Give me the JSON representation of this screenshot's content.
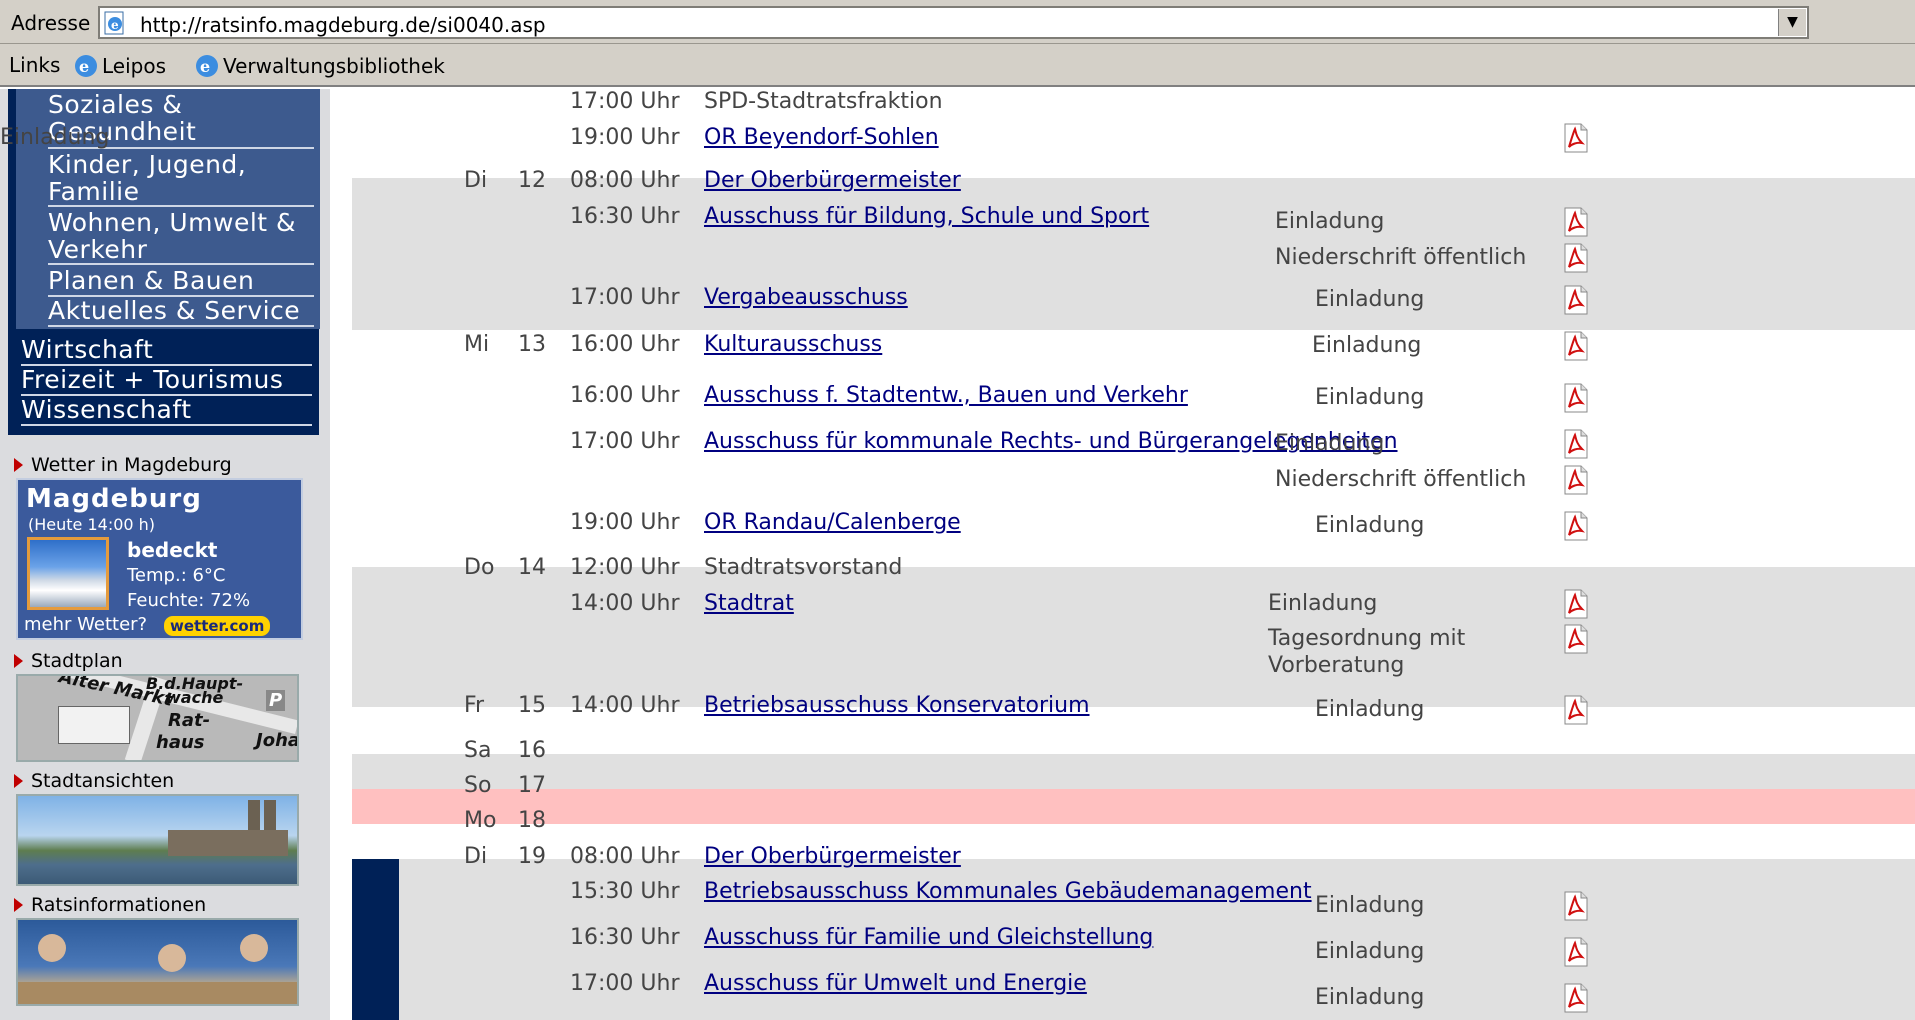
{
  "browser": {
    "address_label": "Adresse",
    "url": "http://ratsinfo.magdeburg.de/si0040.asp",
    "links_label": "Links",
    "links": [
      "Leipos",
      "Verwaltungsbibliothek"
    ]
  },
  "sidebar": {
    "subnav": [
      {
        "line1": "Soziales &",
        "line2": "Gesundheit"
      },
      {
        "line1": "Kinder, Jugend,",
        "line2": "Familie"
      },
      {
        "line1": "Wohnen, Umwelt &",
        "line2": "Verkehr"
      },
      {
        "line1": "Planen & Bauen",
        "line2": ""
      },
      {
        "line1": "Aktuelles & Service",
        "line2": ""
      }
    ],
    "mainnav": [
      "Wirtschaft",
      "Freizeit + Tourismus",
      "Wissenschaft"
    ],
    "weather": {
      "heading": "Wetter in Magdeburg",
      "city": "Magdeburg",
      "time": "(Heute 14:00 h)",
      "condition": "bedeckt",
      "temp": "Temp.:  6°C",
      "humidity": "Feuchte: 72%",
      "more": "mehr Wetter?",
      "badge": "wetter.com"
    },
    "stadtplan": {
      "heading": "Stadtplan",
      "labels": [
        "Alter Markt",
        "B.d.Haupt-",
        "wache",
        "Rat-",
        "haus",
        "Johan",
        "P"
      ]
    },
    "stadtansichten": {
      "heading": "Stadtansichten"
    },
    "ratsinfo": {
      "heading": "Ratsinformationen"
    }
  },
  "calendar": {
    "entries": [
      {
        "day": "",
        "date": "",
        "time": "17:00 Uhr",
        "title": "SPD-Stadtratsfraktion",
        "link": false,
        "docs": []
      },
      {
        "day": "",
        "date": "",
        "time": "19:00 Uhr",
        "title": "OR Beyendorf-Sohlen",
        "link": true,
        "docs": [
          "Einladung"
        ]
      },
      {
        "day": "Di",
        "date": "12",
        "time": "08:00 Uhr",
        "title": "Der Oberbürgermeister",
        "link": true,
        "docs": []
      },
      {
        "day": "",
        "date": "",
        "time": "16:30 Uhr",
        "title": "Ausschuss für Bildung, Schule und Sport",
        "link": true,
        "docs": [
          "Einladung",
          "Niederschrift öffentlich"
        ]
      },
      {
        "day": "",
        "date": "",
        "time": "17:00 Uhr",
        "title": "Vergabeausschuss",
        "link": true,
        "docs": [
          "Einladung"
        ]
      },
      {
        "day": "Mi",
        "date": "13",
        "time": "16:00 Uhr",
        "title": "Kulturausschuss",
        "link": true,
        "docs": [
          "Einladung"
        ]
      },
      {
        "day": "",
        "date": "",
        "time": "16:00 Uhr",
        "title": "Ausschuss f. Stadtentw., Bauen und Verkehr",
        "link": true,
        "docs": [
          "Einladung"
        ]
      },
      {
        "day": "",
        "date": "",
        "time": "17:00 Uhr",
        "title": "Ausschuss für kommunale Rechts- und Bürgerangelegenheiten",
        "link": true,
        "docs": [
          "Einladung",
          "Niederschrift öffentlich"
        ]
      },
      {
        "day": "",
        "date": "",
        "time": "19:00 Uhr",
        "title": "OR Randau/Calenberge",
        "link": true,
        "docs": [
          "Einladung"
        ]
      },
      {
        "day": "Do",
        "date": "14",
        "time": "12:00 Uhr",
        "title": "Stadtratsvorstand",
        "link": false,
        "docs": []
      },
      {
        "day": "",
        "date": "",
        "time": "14:00 Uhr",
        "title": "Stadtrat",
        "link": true,
        "docs": [
          "Einladung",
          "Tagesordnung mit",
          "Vorberatung"
        ]
      },
      {
        "day": "Fr",
        "date": "15",
        "time": "14:00 Uhr",
        "title": "Betriebsausschuss Konservatorium",
        "link": true,
        "docs": [
          "Einladung"
        ]
      },
      {
        "day": "Sa",
        "date": "16",
        "time": "",
        "title": "",
        "link": false,
        "docs": []
      },
      {
        "day": "So",
        "date": "17",
        "time": "",
        "title": "",
        "link": false,
        "docs": []
      },
      {
        "day": "Mo",
        "date": "18",
        "time": "",
        "title": "",
        "link": false,
        "docs": []
      },
      {
        "day": "Di",
        "date": "19",
        "time": "08:00 Uhr",
        "title": "Der Oberbürgermeister",
        "link": true,
        "docs": []
      },
      {
        "day": "",
        "date": "",
        "time": "15:30 Uhr",
        "title": "Betriebsausschuss Kommunales Gebäudemanagement",
        "link": true,
        "docs": [
          "Einladung"
        ]
      },
      {
        "day": "",
        "date": "",
        "time": "16:30 Uhr",
        "title": "Ausschuss für Familie und Gleichstellung",
        "link": true,
        "docs": [
          "Einladung"
        ]
      },
      {
        "day": "",
        "date": "",
        "time": "17:00 Uhr",
        "title": "Ausschuss für Umwelt und Energie",
        "link": true,
        "docs": [
          "Einladung"
        ]
      }
    ]
  },
  "colors": {
    "navy": "#002157",
    "subnav": "#3d5a8e",
    "grey_band": "#e0e0e0",
    "sunday": "#ffc0c0",
    "link": "#000080"
  }
}
